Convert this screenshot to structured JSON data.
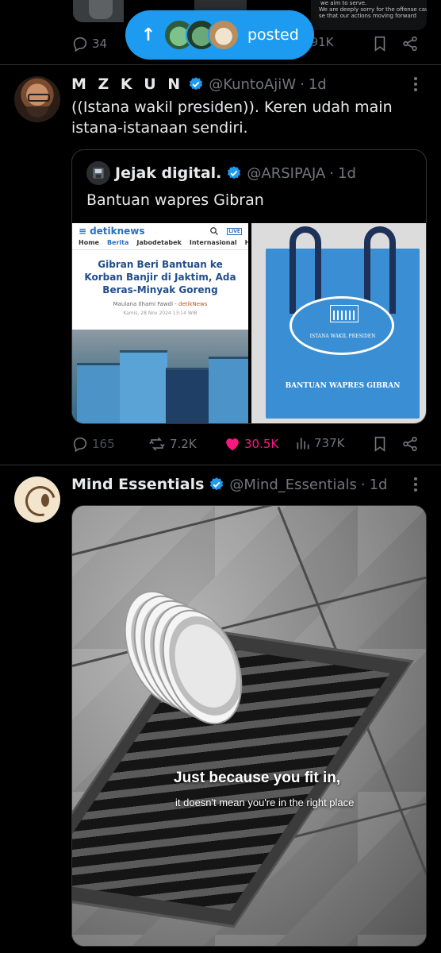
{
  "top_tweet": {
    "media_lines": [
      "we aim to serve.",
      "We are deeply sorry for the offense caused,",
      "se that our actions moving forward"
    ],
    "replies": "34",
    "views": "191K"
  },
  "posted_pill": {
    "arrow": "↑",
    "label": "posted"
  },
  "tweets": [
    {
      "display_name": "M Z K U N",
      "handle": "@KuntoAjiW",
      "dot": "·",
      "time": "1d",
      "text": "((Istana wakil presiden)). Keren udah main istana-istanaan sendiri.",
      "quote": {
        "display_name": "Jejak digital.",
        "handle": "@ARSIPAJA",
        "dot": "·",
        "time": "1d",
        "text": "Bantuan wapres Gibran",
        "media_left": {
          "brand_prefix": "≡",
          "brand": "detiknews",
          "live": "LIVE",
          "nav": [
            "Home",
            "Berita",
            "Jabodetabek",
            "Internasional",
            "Hu"
          ],
          "headline": "Gibran Beri Bantuan ke Korban Banjir di Jaktim, Ada Beras-Minyak Goreng",
          "author_name": "Maulana Ilhami Fawdi",
          "author_sep": " - ",
          "author_source": "detikNews",
          "date": "Kamis, 28 Nov 2024 13:14 WIB"
        },
        "media_right": {
          "oval_label": "ISTANA WAKIL PRESIDEN",
          "caption": "BANTUAN WAPRES GIBRAN"
        }
      },
      "replies": "165",
      "reposts": "7.2K",
      "likes": "30.5K",
      "views": "737K"
    },
    {
      "display_name": "Mind Essentials",
      "handle": "@Mind_Essentials",
      "dot": "·",
      "time": "1d",
      "media_caption_1": "Just because you fit in,",
      "media_caption_2": "it doesn't mean you're in the right place"
    }
  ],
  "colors": {
    "background": "#000000",
    "text": "#e7e9ea",
    "muted": "#71767b",
    "accent": "#1d9bf0",
    "like": "#f91880",
    "border": "#2f3336"
  },
  "icons": {
    "reply": "reply-icon",
    "repost": "repost-icon",
    "like": "heart-icon",
    "views": "views-icon",
    "bookmark": "bookmark-icon",
    "share": "share-icon",
    "verified": "verified-badge-icon",
    "more": "more-icon"
  }
}
